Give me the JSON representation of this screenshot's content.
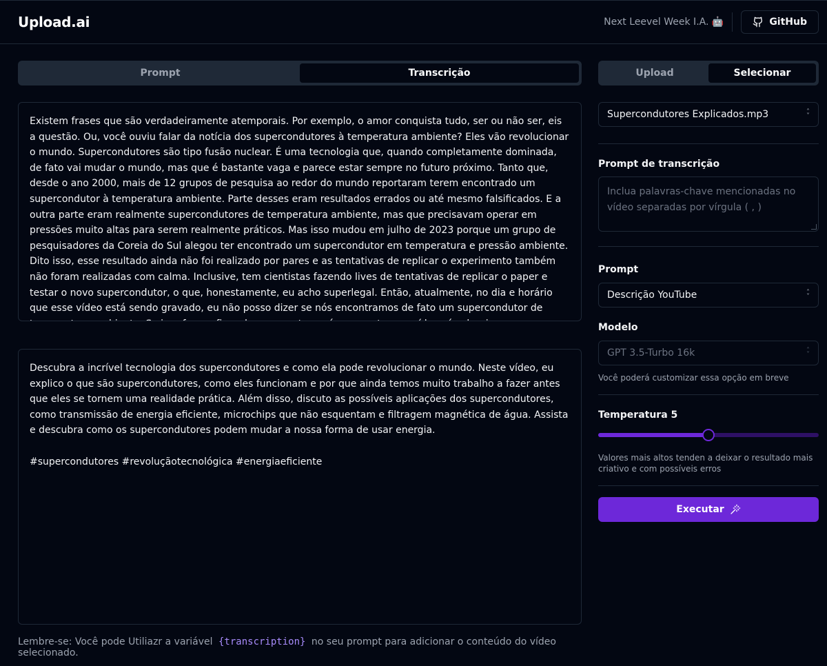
{
  "header": {
    "logo": "Upload.ai",
    "made_with": "Next Leevel Week I.A. 🤖",
    "github_label": "GitHub"
  },
  "left": {
    "tabs": [
      {
        "label": "Prompt",
        "active": false
      },
      {
        "label": "Transcrição",
        "active": true
      }
    ],
    "transcription_text": "Existem frases que são verdadeiramente atemporais. Por exemplo, o amor conquista tudo, ser ou não ser, eis a questão. Ou, você ouviu falar da notícia dos supercondutores à temperatura ambiente? Eles vão revolucionar o mundo. Supercondutores são tipo fusão nuclear. É uma tecnologia que, quando completamente dominada, de fato vai mudar o mundo, mas que é bastante vaga e parece estar sempre no futuro próximo. Tanto que, desde o ano 2000, mais de 12 grupos de pesquisa ao redor do mundo reportaram terem encontrado um supercondutor à temperatura ambiente. Parte desses eram resultados errados ou até mesmo falsificados. E a outra parte eram realmente supercondutores de temperatura ambiente, mas que precisavam operar em pressões muito altas para serem realmente práticos. Mas isso mudou em julho de 2023 porque um grupo de pesquisadores da Coreia do Sul alegou ter encontrado um supercondutor em temperatura e pressão ambiente. Dito isso, esse resultado ainda não foi realizado por pares e as tentativas de replicar o experimento também não foram realizadas com calma. Inclusive, tem cientistas fazendo lives de tentativas de replicar o paper e testar o novo supercondutor, o que, honestamente, eu acho superlegal. Então, atualmente, no dia e horário que esse vídeo está sendo gravado, eu não posso dizer se nós encontramos de fato um supercondutor de temperatura ambiente. Se isso for confirmado, com certeza nós vamos ter um vídeo só sobre isso, provavelmente quando eles ganharem o Nobel de Física",
    "result_text": "Descubra a incrível tecnologia dos supercondutores e como ela pode revolucionar o mundo. Neste vídeo, eu explico o que são supercondutores, como eles funcionam e por que ainda temos muito trabalho a fazer antes que eles se tornem uma realidade prática. Além disso, discuto as possíveis aplicações dos supercondutores, como transmissão de energia eficiente, microchips que não esquentam e filtragem magnética de água. Assista e descubra como os supercondutores podem mudar a nossa forma de usar energia.\n\n#supercondutores #revoluçãotecnológica #energiaeficiente",
    "hint_before": "Lembre-se: Você pode Utiliazr a variável",
    "hint_var": "{transcription}",
    "hint_after": "no seu prompt para adicionar o conteúdo do vídeo selecionado."
  },
  "right": {
    "tabs": [
      {
        "label": "Upload",
        "active": false
      },
      {
        "label": "Selecionar",
        "active": true
      }
    ],
    "video_select": "Supercondutores Explicados.mp3",
    "transcription_prompt_label": "Prompt de transcrição",
    "transcription_prompt_placeholder": "Inclua palavras-chave mencionadas no vídeo separadas por vírgula ( , )",
    "prompt_label": "Prompt",
    "prompt_select": "Descrição YouTube",
    "model_label": "Modelo",
    "model_select": "GPT 3.5-Turbo 16k",
    "model_note": "Você poderá customizar essa opção em breve",
    "temperature_label": "Temperatura 5",
    "temperature_fraction": 0.5,
    "temperature_note": "Valores mais altos tenden a deixar o resultado mais criativo e com possíveis erros",
    "execute_label": "Executar"
  },
  "colors": {
    "background": "#030712",
    "border": "#1f2937",
    "accent": "#6d28d9",
    "accent_text": "#a78bfa"
  }
}
